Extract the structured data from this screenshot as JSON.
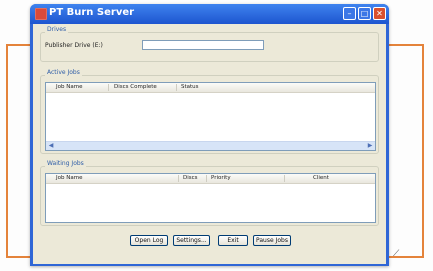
{
  "window": {
    "title": "PT Burn Server"
  },
  "titlebar_controls": {
    "minimize": "–",
    "maximize": "□",
    "close": "✕"
  },
  "drives": {
    "group_title": "Drives",
    "publisher_drive_label": "Publisher Drive (E:)",
    "publisher_drive_value": ""
  },
  "active_jobs": {
    "group_title": "Active Jobs",
    "columns": [
      "Job Name",
      "Discs Complete",
      "Status"
    ],
    "rows": [],
    "scroll_left": "◀",
    "scroll_right": "▶"
  },
  "waiting_jobs": {
    "group_title": "Waiting Jobs",
    "columns": [
      "Job Name",
      "Discs",
      "Priority",
      "Client"
    ],
    "rows": []
  },
  "buttons": {
    "open_log": "Open Log",
    "settings": "Settings...",
    "exit": "Exit",
    "pause_jobs": "Pause Jobs"
  },
  "resize_grip": "⟋"
}
